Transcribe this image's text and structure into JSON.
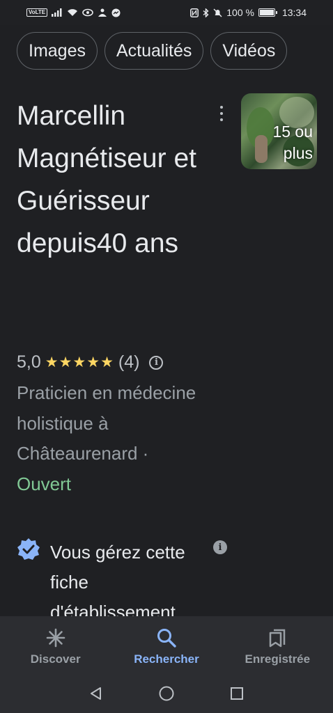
{
  "status_bar": {
    "volte": "VoLTE",
    "battery_text": "100 %",
    "battery_level": 1.0,
    "time": "13:34"
  },
  "chips": [
    {
      "label": "Images"
    },
    {
      "label": "Actualités"
    },
    {
      "label": "Vidéos"
    }
  ],
  "business": {
    "title": "Marcellin Magnétiseur et Guérisseur depuis40 ans",
    "photo_count": "15 ou plus",
    "rating": "5,0",
    "stars": "★★★★★",
    "star_value": 5,
    "reviews": "(4)",
    "category": "Praticien en médecine holistique à Châteaurenard ·",
    "open_status": "Ouvert",
    "managed_text": "Vous gérez cette fiche d'établissement"
  },
  "bottom_nav": {
    "items": [
      {
        "label": "Discover",
        "icon": "asterisk-icon"
      },
      {
        "label": "Rechercher",
        "icon": "search-icon"
      },
      {
        "label": "Enregistrée",
        "icon": "bookmarks-icon"
      }
    ],
    "active": "Rechercher"
  },
  "colors": {
    "background": "#1f2023",
    "accent": "#8ab4f8",
    "open": "#81c995",
    "stars": "#fdd663",
    "verified": "#8ab4f8"
  }
}
